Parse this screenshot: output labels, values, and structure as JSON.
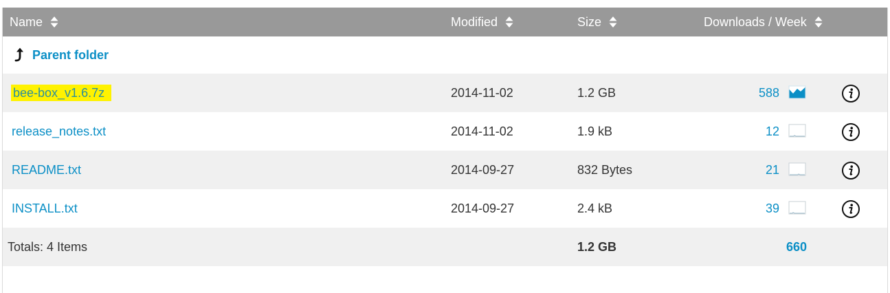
{
  "header": {
    "name": "Name",
    "modified": "Modified",
    "size": "Size",
    "downloads": "Downloads / Week"
  },
  "parent_folder": {
    "label": "Parent folder",
    "icon": "up-arrow-icon"
  },
  "files": [
    {
      "name": "bee-box_v1.6.7z",
      "modified": "2014-11-02",
      "size": "1.2 GB",
      "downloads": "588",
      "highlighted": true,
      "sparkline": "filled"
    },
    {
      "name": "release_notes.txt",
      "modified": "2014-11-02",
      "size": "1.9 kB",
      "downloads": "12",
      "highlighted": false,
      "sparkline": "empty"
    },
    {
      "name": "README.txt",
      "modified": "2014-09-27",
      "size": "832 Bytes",
      "downloads": "21",
      "highlighted": false,
      "sparkline": "empty"
    },
    {
      "name": "INSTALL.txt",
      "modified": "2014-09-27",
      "size": "2.4 kB",
      "downloads": "39",
      "highlighted": false,
      "sparkline": "empty"
    }
  ],
  "totals": {
    "label": "Totals: 4 Items",
    "size": "1.2 GB",
    "downloads": "660"
  },
  "colors": {
    "header_bg": "#999999",
    "link": "#0b8fc6",
    "highlight": "#fff200",
    "row_shade": "#f0f0f0"
  }
}
